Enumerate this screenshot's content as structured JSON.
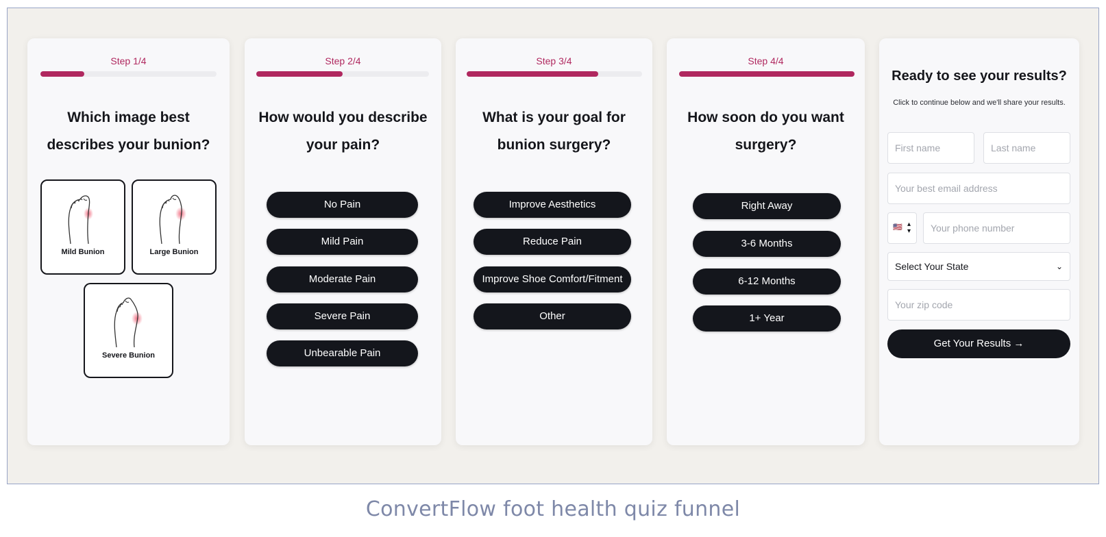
{
  "caption": "ConvertFlow foot health quiz funnel",
  "colors": {
    "accent": "#b0285f",
    "button": "#14161c",
    "card": "#f8f8fa",
    "background": "#f2f0ec"
  },
  "steps": [
    {
      "label": "Step 1/4",
      "progress": 0.25,
      "question": "Which image best describes your bunion?",
      "image_options": [
        {
          "label": "Mild Bunion",
          "icon": "foot-mild-bunion-icon"
        },
        {
          "label": "Large Bunion",
          "icon": "foot-large-bunion-icon"
        },
        {
          "label": "Severe Bunion",
          "icon": "foot-severe-bunion-icon"
        }
      ]
    },
    {
      "label": "Step 2/4",
      "progress": 0.5,
      "question": "How would you describe your pain?",
      "options": [
        "No Pain",
        "Mild Pain",
        "Moderate Pain",
        "Severe Pain",
        "Unbearable Pain"
      ]
    },
    {
      "label": "Step 3/4",
      "progress": 0.75,
      "question": "What is your goal for bunion surgery?",
      "options": [
        "Improve Aesthetics",
        "Reduce Pain",
        "Improve Shoe Comfort/Fitment",
        "Other"
      ]
    },
    {
      "label": "Step 4/4",
      "progress": 1.0,
      "question": "How soon do you want surgery?",
      "options": [
        "Right Away",
        "3-6 Months",
        "6-12 Months",
        "1+ Year"
      ]
    }
  ],
  "form": {
    "title": "Ready to see your results?",
    "subtitle": "Click to continue below and we'll share your results.",
    "first_name_placeholder": "First name",
    "last_name_placeholder": "Last name",
    "email_placeholder": "Your best email address",
    "phone_flag": "🇺🇸",
    "phone_placeholder": "Your phone number",
    "state_select": "Select Your State",
    "zip_placeholder": "Your zip code",
    "submit_label": "Get Your Results →"
  }
}
